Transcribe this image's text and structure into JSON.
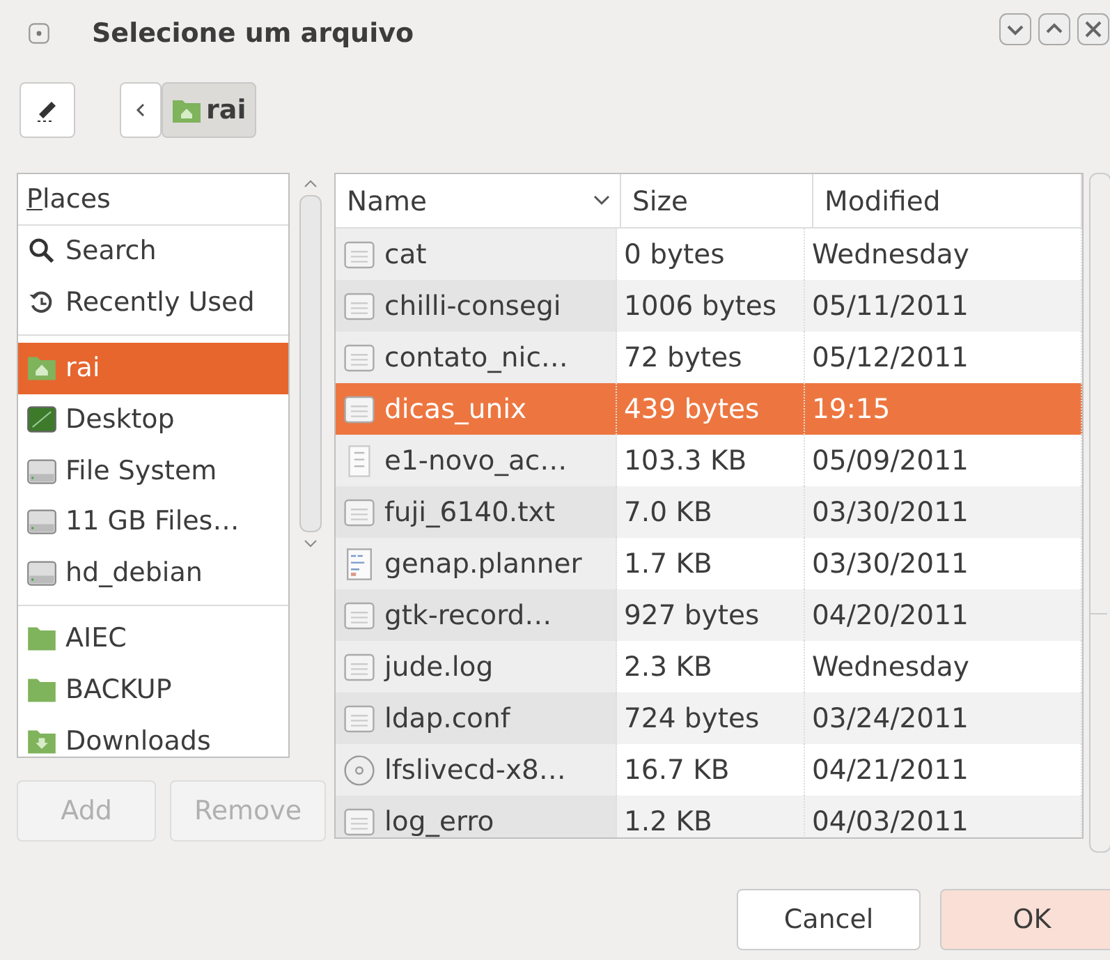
{
  "window": {
    "title": "Selecione um arquivo"
  },
  "path_bar": {
    "segments": [
      {
        "label": "rai",
        "selected": true
      }
    ]
  },
  "places": {
    "heading": "Places",
    "groups": [
      [
        {
          "label": "Search",
          "kind": "search",
          "selected": false
        },
        {
          "label": "Recently Used",
          "kind": "recent",
          "selected": false
        }
      ],
      [
        {
          "label": "rai",
          "kind": "home",
          "selected": true
        },
        {
          "label": "Desktop",
          "kind": "desktop",
          "selected": false
        },
        {
          "label": "File System",
          "kind": "drive",
          "selected": false
        },
        {
          "label": "11 GB Files…",
          "kind": "drive",
          "selected": false
        },
        {
          "label": "hd_debian",
          "kind": "drive",
          "selected": false
        }
      ],
      [
        {
          "label": "AIEC",
          "kind": "folder",
          "selected": false
        },
        {
          "label": "BACKUP",
          "kind": "folder",
          "selected": false
        },
        {
          "label": "Downloads",
          "kind": "download",
          "selected": false
        }
      ]
    ]
  },
  "place_buttons": [
    {
      "label": "Add",
      "disabled": true
    },
    {
      "label": "Remove",
      "disabled": true
    }
  ],
  "files": {
    "columns": [
      "Name",
      "Size",
      "Modified"
    ],
    "rows": [
      {
        "name": "cat",
        "size": "0 bytes",
        "modified": "Wednesday",
        "kind": "text",
        "selected": false
      },
      {
        "name": "chilli-consegi",
        "size": "1006 bytes",
        "modified": "05/11/2011",
        "kind": "text",
        "selected": false
      },
      {
        "name": "contato_nic…",
        "size": "72 bytes",
        "modified": "05/12/2011",
        "kind": "text",
        "selected": false
      },
      {
        "name": "dicas_unix",
        "size": "439 bytes",
        "modified": "19:15",
        "kind": "text",
        "selected": true
      },
      {
        "name": "e1-novo_ac…",
        "size": "103.3 KB",
        "modified": "05/09/2011",
        "kind": "image",
        "selected": false
      },
      {
        "name": "fuji_6140.txt",
        "size": "7.0 KB",
        "modified": "03/30/2011",
        "kind": "text",
        "selected": false
      },
      {
        "name": "genap.planner",
        "size": "1.7 KB",
        "modified": "03/30/2011",
        "kind": "planner",
        "selected": false
      },
      {
        "name": "gtk-record…",
        "size": "927 bytes",
        "modified": "04/20/2011",
        "kind": "text",
        "selected": false
      },
      {
        "name": "jude.log",
        "size": "2.3 KB",
        "modified": "Wednesday",
        "kind": "text",
        "selected": false
      },
      {
        "name": "ldap.conf",
        "size": "724 bytes",
        "modified": "03/24/2011",
        "kind": "text",
        "selected": false
      },
      {
        "name": "lfslivecd-x8…",
        "size": "16.7 KB",
        "modified": "04/21/2011",
        "kind": "disc",
        "selected": false
      },
      {
        "name": "log_erro",
        "size": "1.2 KB",
        "modified": "04/03/2011",
        "kind": "text",
        "selected": false
      }
    ]
  },
  "buttons": [
    {
      "label": "Cancel",
      "kind": "normal"
    },
    {
      "label": "OK",
      "kind": "default"
    }
  ]
}
